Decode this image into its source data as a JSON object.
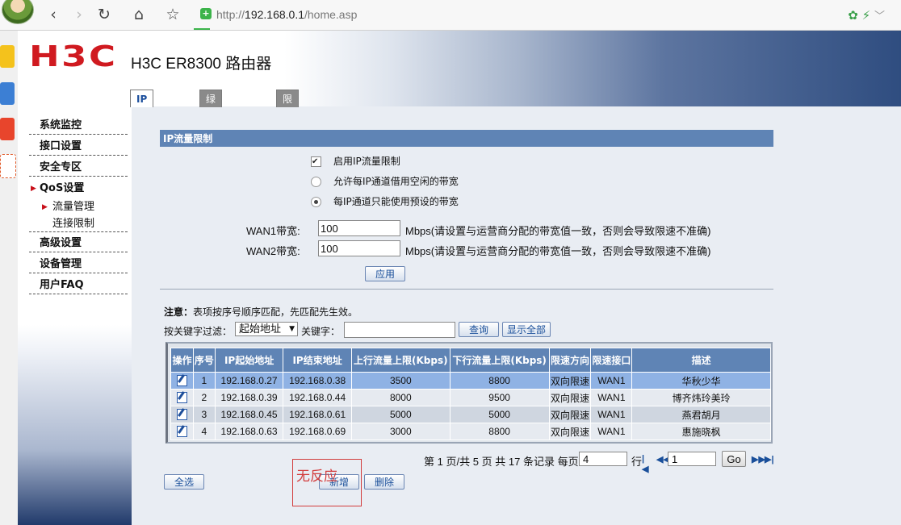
{
  "browser": {
    "url_prefix": "http://",
    "url_host": "192.168.0.1",
    "url_path": "/home.asp",
    "back_icon": "‹",
    "forward_icon": "›",
    "reload_icon": "↻",
    "home_icon": "⌂",
    "star_icon": "☆"
  },
  "header": {
    "logo": "H3C",
    "title": "H3C ER8300 路由器"
  },
  "tabs": [
    {
      "label": "IP流量限制",
      "active": true
    },
    {
      "label": "绿色通道管理",
      "active": false
    },
    {
      "label": "限制通道管理",
      "active": false
    }
  ],
  "nav": {
    "items": [
      {
        "label": "系统监控"
      },
      {
        "label": "接口设置"
      },
      {
        "label": "安全专区"
      },
      {
        "label": "QoS设置"
      },
      {
        "label": "高级设置"
      },
      {
        "label": "设备管理"
      },
      {
        "label": "用户FAQ"
      }
    ],
    "sub_items": [
      {
        "label": "流量管理"
      },
      {
        "label": "连接限制"
      }
    ]
  },
  "section": {
    "title": "IP流量限制",
    "enable_label": "启用IP流量限制",
    "enable_checked": true,
    "option_borrow": "允许每IP通道借用空闲的带宽",
    "option_fixed": "每IP通道只能使用预设的带宽",
    "selected_option": "fixed",
    "wan1_label": "WAN1带宽:",
    "wan1_value": "100",
    "wan2_label": "WAN2带宽:",
    "wan2_value": "100",
    "unit_note": "Mbps(请设置与运营商分配的带宽值一致，否则会导致限速不准确)",
    "apply_label": "应用"
  },
  "list": {
    "notice_bold": "注意：",
    "notice_text": "表项按序号顺序匹配，先匹配先生效。",
    "filter_label": "按关键字过滤：",
    "filter_select": "起始地址",
    "keyword_label": "关键字：",
    "keyword_value": "",
    "search_label": "查询",
    "show_all_label": "显示全部",
    "columns": [
      "操作",
      "序号",
      "IP起始地址",
      "IP结束地址",
      "上行流量上限(Kbps)",
      "下行流量上限(Kbps)",
      "限速方向",
      "限速接口",
      "描述"
    ],
    "rows": [
      {
        "no": "1",
        "start": "192.168.0.27",
        "end": "192.168.0.38",
        "up": "3500",
        "down": "8800",
        "dir": "双向限速",
        "iface": "WAN1",
        "desc": "华秋少华"
      },
      {
        "no": "2",
        "start": "192.168.0.39",
        "end": "192.168.0.44",
        "up": "8000",
        "down": "9500",
        "dir": "双向限速",
        "iface": "WAN1",
        "desc": "博齐炜玲美玲"
      },
      {
        "no": "3",
        "start": "192.168.0.45",
        "end": "192.168.0.61",
        "up": "5000",
        "down": "5000",
        "dir": "双向限速",
        "iface": "WAN1",
        "desc": "燕君胡月"
      },
      {
        "no": "4",
        "start": "192.168.0.63",
        "end": "192.168.0.69",
        "up": "3000",
        "down": "8800",
        "dir": "双向限速",
        "iface": "WAN1",
        "desc": "惠施晓枫"
      }
    ]
  },
  "pager": {
    "text_pre": "第",
    "current": "1",
    "text_mid": "页/共",
    "total_pages": "5",
    "text_mid2": "页 共",
    "total_records": "17",
    "text_mid3": "条记录 每页",
    "per_page": "4",
    "text_row": "行",
    "goto_value": "1",
    "go_label": "Go"
  },
  "actions": {
    "select_all": "全选",
    "add": "新增",
    "delete": "删除"
  },
  "annotation": {
    "text": "无反应"
  }
}
